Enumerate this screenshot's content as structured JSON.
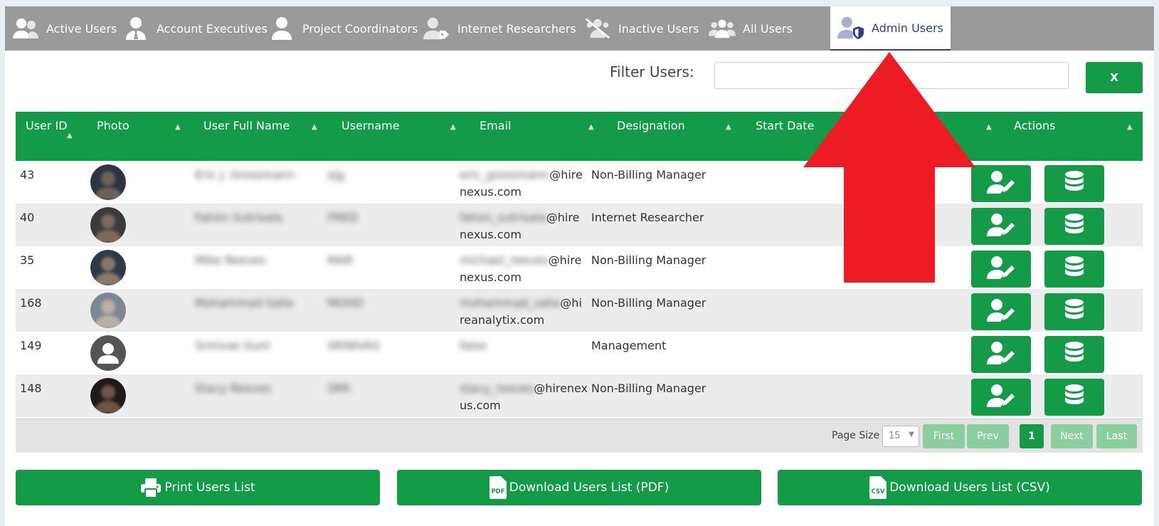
{
  "tabs": [
    {
      "label": "Active Users",
      "icon": "users-icon"
    },
    {
      "label": "Account Executives",
      "icon": "user-tie-icon"
    },
    {
      "label": "Project Coordinators",
      "icon": "user-icon"
    },
    {
      "label": "Internet Researchers",
      "icon": "user-tag-icon"
    },
    {
      "label": "Inactive Users",
      "icon": "users-slash-icon"
    },
    {
      "label": "All Users",
      "icon": "users-group-icon"
    },
    {
      "label": "Admin Users",
      "icon": "user-shield-icon",
      "active": true
    }
  ],
  "filter": {
    "label": "Filter Users:",
    "value": "",
    "clear_label": "X"
  },
  "table": {
    "columns": [
      "User ID",
      "Photo",
      "User Full Name",
      "Username",
      "Email",
      "Designation",
      "Start Date",
      "Actions"
    ],
    "rows": [
      {
        "id": "43",
        "name": "Eric J. Grossmann",
        "username": "ejg",
        "email_user": "eric_grossmann",
        "email_line1": "@hire",
        "email_line2": "nexus.com",
        "designation": "Non-Billing Manager",
        "photo": "photo"
      },
      {
        "id": "40",
        "name": "Fahim Sutrisala",
        "username": "FRED",
        "email_user": "fahim_sutrisala",
        "email_line1": "@hire",
        "email_line2": "nexus.com",
        "designation": "Internet Researcher",
        "photo": "photo"
      },
      {
        "id": "35",
        "name": "Mike Reeves",
        "username": "MAR",
        "email_user": "michael_reeves",
        "email_line1": "@hire",
        "email_line2": "nexus.com",
        "designation": "Non-Billing Manager",
        "photo": "photo"
      },
      {
        "id": "168",
        "name": "Mohammad Salia",
        "username": "MOHD",
        "email_user": "mohammad_salia",
        "email_line1": "@hi",
        "email_line2": "reanalytix.com",
        "designation": "Non-Billing Manager",
        "photo": "photo"
      },
      {
        "id": "149",
        "name": "Srinivas Guni",
        "username": "SRINIVAS",
        "email_user": "false",
        "email_line1": "",
        "email_line2": "",
        "designation": "Management",
        "photo": "placeholder"
      },
      {
        "id": "148",
        "name": "Stacy Reeves",
        "username": "SRR",
        "email_user": "stacy_reeves",
        "email_line1": "@hirenex",
        "email_line2": "us.com",
        "designation": "Non-Billing Manager",
        "photo": "photo"
      }
    ],
    "action_icons": [
      "user-edit-icon",
      "database-icon"
    ]
  },
  "pager": {
    "size_label": "Page Size",
    "size_value": "15",
    "first": "First",
    "prev": "Prev",
    "current": "1",
    "next": "Next",
    "last": "Last"
  },
  "bottom_buttons": [
    {
      "label": "Print Users List",
      "icon": "printer-icon"
    },
    {
      "label": "Download Users List (PDF)",
      "icon": "pdf-file-icon",
      "icon_text": "PDF"
    },
    {
      "label": "Download Users List (CSV)",
      "icon": "csv-file-icon",
      "icon_text": "CSV"
    }
  ],
  "colors": {
    "green": "#149b47",
    "tabbar": "#9a9a9a",
    "active_tab_text": "#2d3e8f",
    "arrow": "#ed1c24"
  }
}
